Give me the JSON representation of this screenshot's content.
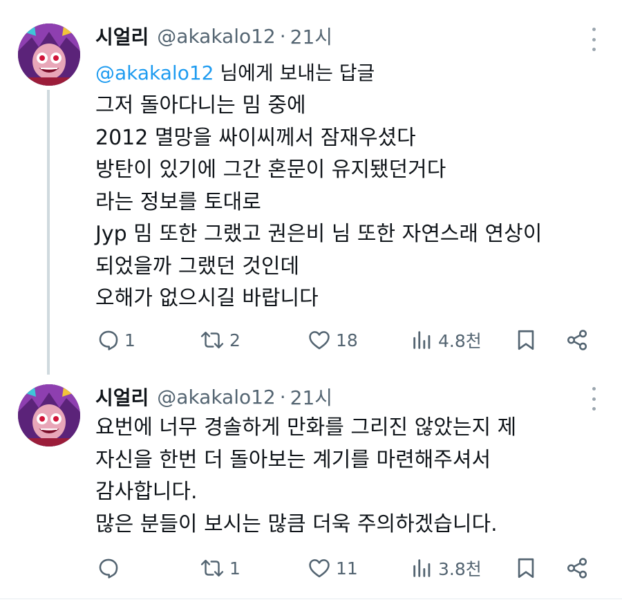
{
  "tweets": [
    {
      "author": {
        "name": "시얼리",
        "handle": "@akakalo12",
        "time": "21시"
      },
      "reply_to": {
        "mention": "@akakalo12",
        "suffix": " 님에게 보내는 답글"
      },
      "lines": [
        "그저 돌아다니는 밈 중에",
        "2012 멸망을 싸이씨께서 잠재우셨다",
        "방탄이 있기에 그간 혼문이 유지됐던거다",
        "라는 정보를 토대로",
        "Jyp 밈 또한 그랬고 권은비 님 또한 자연스래 연상이",
        "되었을까 그랬던 것인데",
        "오해가 없으시길 바랍니다"
      ],
      "stats": {
        "replies": "1",
        "reposts": "2",
        "likes": "18",
        "views": "4.8천"
      }
    },
    {
      "author": {
        "name": "시얼리",
        "handle": "@akakalo12",
        "time": "21시"
      },
      "lines": [
        "요번에 너무 경솔하게 만화를 그리진 않았는지 제",
        "자신을 한번 더 돌아보는 계기를 마련해주셔서",
        "감사합니다.",
        "많은 분들이 보시는 많큼 더욱 주의하겠습니다."
      ],
      "stats": {
        "replies": "",
        "reposts": "1",
        "likes": "11",
        "views": "3.8천"
      }
    }
  ],
  "icons": {
    "reply": "speech-bubble",
    "repost": "repost-arrows",
    "like": "heart",
    "views": "bar-chart",
    "bookmark": "bookmark",
    "share": "share-nodes",
    "more": "vertical-dots"
  },
  "colors": {
    "link": "#1d9bf0",
    "secondary_text": "#536471",
    "thread_line": "#cfd9de"
  }
}
